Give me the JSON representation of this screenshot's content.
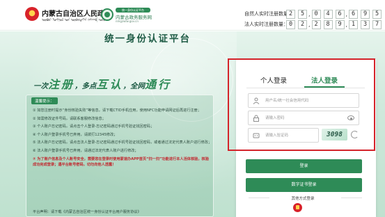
{
  "header": {
    "gov_title": "内蒙古自治区人民政府",
    "gov_mongol": "ᠥᠪᠦᠷ ᠮᠣᠩᠭᠣᠯ ᠤᠨ ᠥᠪᠡᠷᠲᠡᠭᠡᠨ ᠵᠠᠰᠠᠬᠤ ᠣᠷᠤᠨ",
    "service_badge": "统一身份认证平台",
    "service_name": "内蒙古政务服务网",
    "service_en": "nmgzwfw.gov.cn"
  },
  "stats": {
    "person_label": "自然人实时注册数量：",
    "person_digits": [
      "2",
      "5",
      ",",
      "0",
      "4",
      "6",
      ",",
      "6",
      "9",
      "5"
    ],
    "legal_label": "法人实时注册数量：",
    "legal_digits": [
      "0",
      "2",
      ",",
      "2",
      "8",
      "9",
      ",",
      "1",
      "3",
      "7"
    ]
  },
  "hero": {
    "title": "统一身份认证平台",
    "slogan": [
      {
        "text": "一次",
        "big": false
      },
      {
        "text": "注册",
        "big": true
      },
      {
        "text": "，多点",
        "big": false
      },
      {
        "text": "互认",
        "big": true
      },
      {
        "text": "，全网",
        "big": false
      },
      {
        "text": "通行",
        "big": true
      }
    ]
  },
  "notice": {
    "title": "温馨提示：",
    "items": [
      {
        "text": "① 如您注册时提示“身份核验失败”等信息，请下载CTID手机应用，使用NFC功能申请网证后再进行注册；",
        "warn": false
      },
      {
        "text": "② 如需修改证件号码，请联系客服修改信息；",
        "warn": false
      },
      {
        "text": "③ 个人账户忘记密码，请点击个人登录-忘记密码通过手机号验证找回密码；",
        "warn": false
      },
      {
        "text": "④ 个人账户登录手机号已弃用，请拨打12345修改；",
        "warn": false
      },
      {
        "text": "⑤ 法人账户忘记密码，请点击法人登录-忘记密码通过手机号验证找回密码，或者通过法定代表人账户进行修改；",
        "warn": false
      },
      {
        "text": "⑥ 法人账户登录手机号已弃用，请通过法定代表人账户进行修改；",
        "warn": false
      },
      {
        "text": "⑦ 为了账户信息及个人账号安全，需要您在登录时使用蒙速办APP首页“扫一扫”功能进行本人活体核验，核验成功完成登录；遇平台账号密码，切勿向他人透露！",
        "warn": true
      }
    ],
    "footer": "平台声明：请下载《内蒙古自治区统一身份认证平台用户服务协议》"
  },
  "login": {
    "tabs": [
      {
        "label": "个人登录",
        "active": false
      },
      {
        "label": "法人登录",
        "active": true
      }
    ],
    "username_placeholder": "用户名/统一社会信用代码",
    "password_placeholder": "请输入密码",
    "captcha_placeholder": "请输入验证码",
    "captcha_text": "3098",
    "login_button": "登录",
    "cert_button": "数字证书登录",
    "other_methods": "其他方式登录"
  },
  "colors": {
    "brand_green": "#2e8b57",
    "highlight_red": "#d4232a"
  }
}
